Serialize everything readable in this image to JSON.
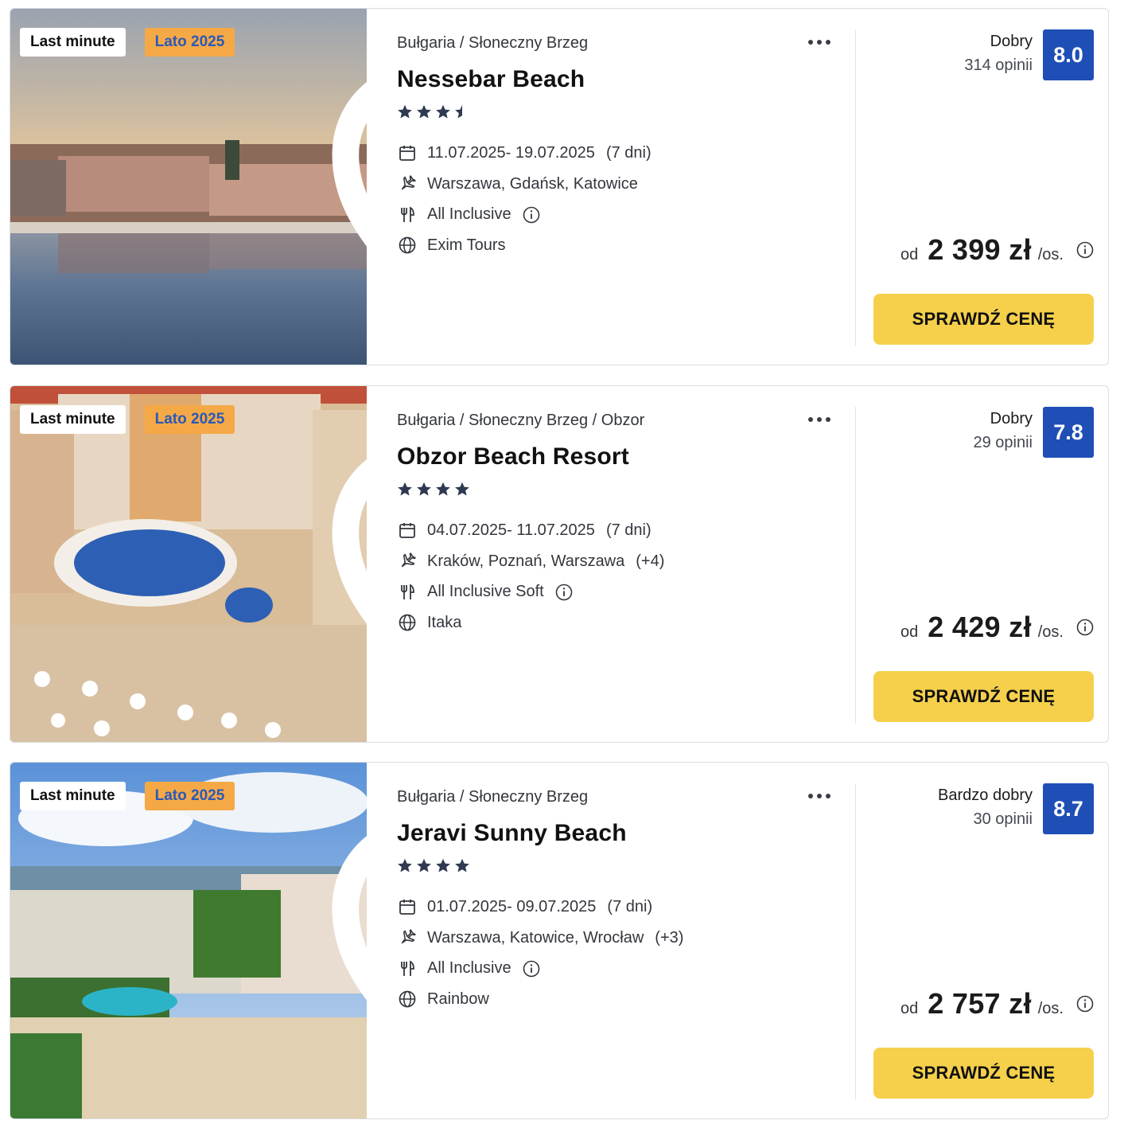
{
  "icons": {
    "favorite": "heart-outline-icon",
    "more": "more-dots-icon",
    "date": "calendar-icon",
    "departure": "plane-icon",
    "board": "cutlery-icon",
    "operator": "globe-icon",
    "info": "info-icon",
    "rating_star": "star-icon"
  },
  "colors": {
    "score_bg": "#1f4fb6",
    "season_badge_bg": "#f5a946",
    "season_badge_text": "#2a59b9",
    "cta_bg": "#f6d04b"
  },
  "offers": [
    {
      "badge_primary": "Last minute",
      "badge_season": "Lato 2025",
      "breadcrumb": "Bułgaria / Słoneczny Brzeg",
      "name": "Nessebar Beach",
      "stars": 3.5,
      "dates": "11.07.2025- 19.07.2025",
      "duration": "(7 dni)",
      "departures": "Warszawa, Gdańsk, Katowice",
      "departures_extra": "",
      "board": "All Inclusive",
      "operator": "Exim Tours",
      "rating_label": "Dobry",
      "rating_count": "314 opinii",
      "score": "8.0",
      "price_prefix": "od",
      "price": "2 399 zł",
      "price_unit": "/os.",
      "cta": "SPRAWDŹ CENĘ"
    },
    {
      "badge_primary": "Last minute",
      "badge_season": "Lato 2025",
      "breadcrumb": "Bułgaria / Słoneczny Brzeg / Obzor",
      "name": "Obzor Beach Resort",
      "stars": 4,
      "dates": "04.07.2025- 11.07.2025",
      "duration": "(7 dni)",
      "departures": "Kraków, Poznań, Warszawa",
      "departures_extra": "(+4)",
      "board": "All Inclusive Soft",
      "operator": "Itaka",
      "rating_label": "Dobry",
      "rating_count": "29 opinii",
      "score": "7.8",
      "price_prefix": "od",
      "price": "2 429 zł",
      "price_unit": "/os.",
      "cta": "SPRAWDŹ CENĘ"
    },
    {
      "badge_primary": "Last minute",
      "badge_season": "Lato 2025",
      "breadcrumb": "Bułgaria / Słoneczny Brzeg",
      "name": "Jeravi Sunny Beach",
      "stars": 4,
      "dates": "01.07.2025- 09.07.2025",
      "duration": "(7 dni)",
      "departures": "Warszawa, Katowice, Wrocław",
      "departures_extra": "(+3)",
      "board": "All Inclusive",
      "operator": "Rainbow",
      "rating_label": "Bardzo dobry",
      "rating_count": "30 opinii",
      "score": "8.7",
      "price_prefix": "od",
      "price": "2 757 zł",
      "price_unit": "/os.",
      "cta": "SPRAWDŹ CENĘ"
    }
  ]
}
